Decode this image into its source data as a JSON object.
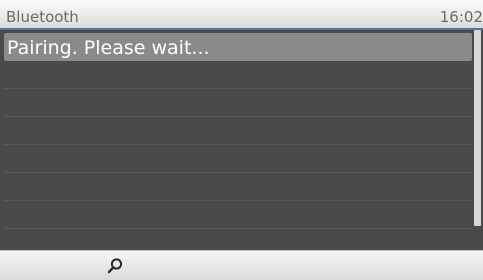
{
  "title_bar": {
    "title": "Bluetooth",
    "time": "16:02"
  },
  "list": {
    "items": [
      {
        "label": "Pairing. Please wait...",
        "selected": true
      },
      {
        "label": ""
      },
      {
        "label": ""
      },
      {
        "label": ""
      },
      {
        "label": ""
      },
      {
        "label": ""
      },
      {
        "label": ""
      }
    ]
  },
  "soft_keys": {
    "search_icon": "search-icon"
  },
  "colors": {
    "title_underline": "#5a6fa8",
    "list_background": "#4a4a4a",
    "selection": "#8a8a8a"
  }
}
